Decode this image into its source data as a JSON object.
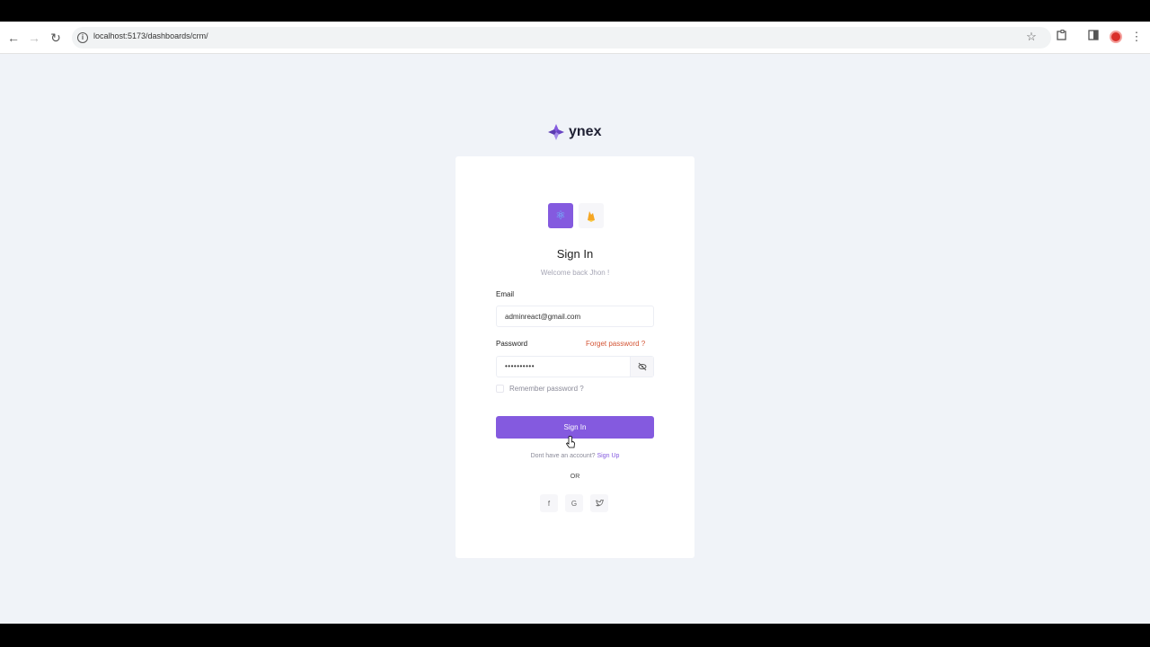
{
  "browser": {
    "url": "localhost:5173/dashboards/crm/",
    "back_icon": "←",
    "forward_icon": "→",
    "reload_icon": "↻"
  },
  "brand": {
    "name": "ynex"
  },
  "card": {
    "tabs": [
      {
        "name": "react-tab",
        "icon": "⚛",
        "active": true
      },
      {
        "name": "firebase-tab",
        "icon": "🔥",
        "active": false
      }
    ],
    "title": "Sign In",
    "subtitle": "Welcome back Jhon !",
    "email_label": "Email",
    "email_value": "adminreact@gmail.com",
    "password_label": "Password",
    "forget_link": "Forget password ?",
    "password_value": "••••••••••",
    "remember_label": "Remember password ?",
    "signin_button": "Sign In",
    "signup_prompt": "Dont have an account?",
    "signup_link": "Sign Up",
    "or_text": "OR",
    "social": [
      {
        "name": "facebook-button",
        "glyph": "f"
      },
      {
        "name": "google-button",
        "glyph": "G"
      },
      {
        "name": "twitter-button",
        "glyph": "t"
      }
    ]
  },
  "colors": {
    "primary": "#845adf",
    "danger": "#d35434",
    "page_bg": "#f0f3f8"
  }
}
